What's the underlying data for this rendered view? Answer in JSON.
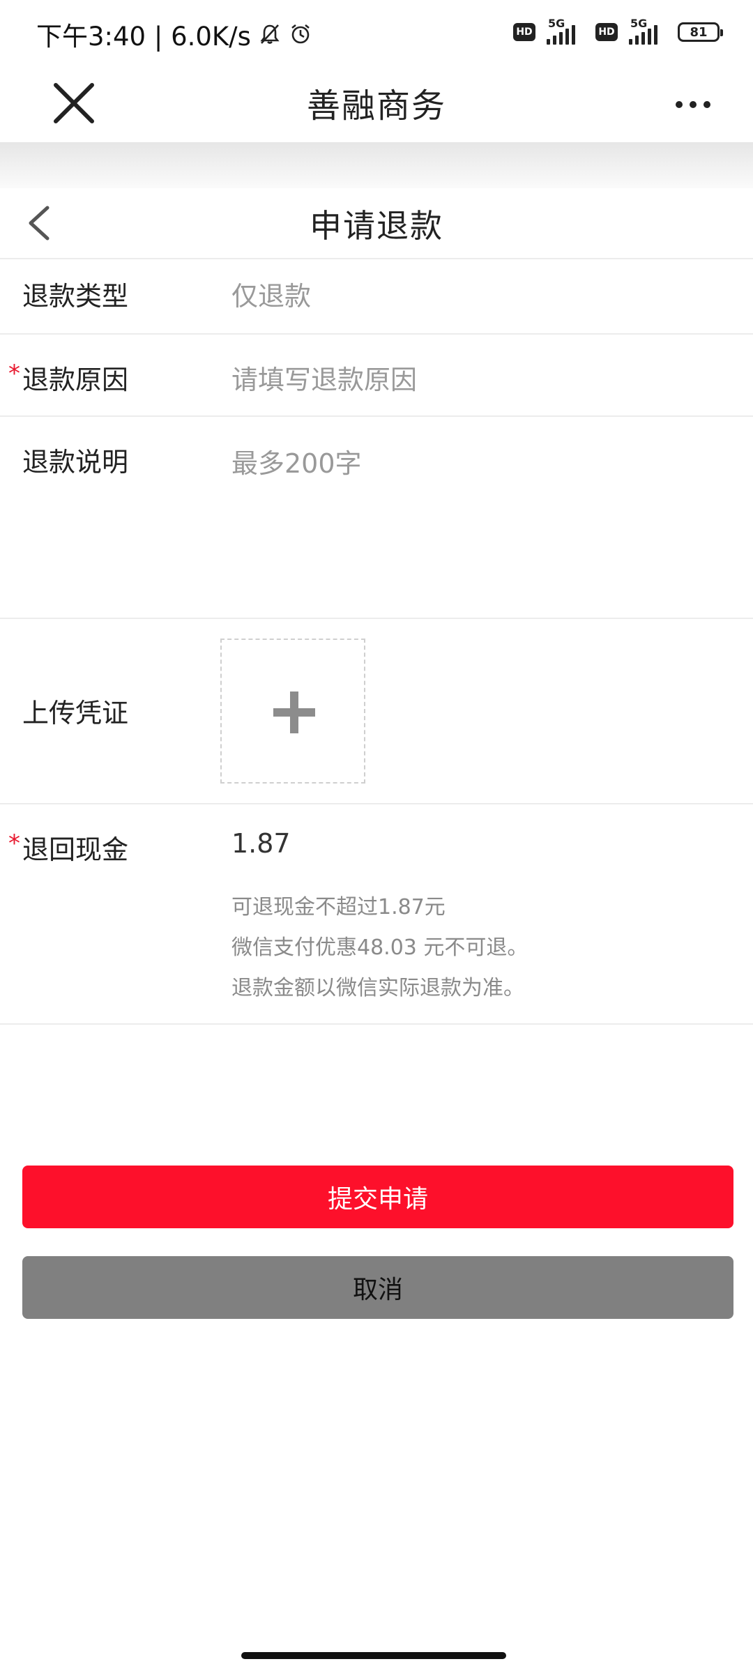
{
  "status_bar": {
    "time_speed": "下午3:40 | 6.0K/s",
    "icons": [
      "bell-muted-icon",
      "alarm-clock-icon",
      "hd-icon",
      "signal-5g-icon",
      "battery-icon"
    ],
    "network_1": "5G",
    "network_2": "5G",
    "hd_label": "HD",
    "battery_level": "81"
  },
  "navbar": {
    "title": "善融商务",
    "close_icon": "close-icon",
    "more_icon": "more-icon"
  },
  "page": {
    "title": "申请退款",
    "back_icon": "back-arrow-icon"
  },
  "form": {
    "refund_type": {
      "label": "退款类型",
      "value": "仅退款"
    },
    "refund_reason": {
      "required_mark": "*",
      "label": "退款原因",
      "placeholder": "请填写退款原因"
    },
    "refund_note": {
      "label": "退款说明",
      "placeholder": "最多200字"
    },
    "upload": {
      "label": "上传凭证",
      "icon": "plus-icon"
    },
    "refund_cash": {
      "required_mark": "*",
      "label": "退回现金",
      "value": "1.87",
      "hints": [
        "可退现金不超过1.87元",
        "微信支付优惠48.03 元不可退。",
        "退款金额以微信实际退款为准。"
      ]
    }
  },
  "buttons": {
    "submit": "提交申请",
    "cancel": "取消"
  },
  "colors": {
    "accent_red": "#fd102b",
    "cancel_gray": "#808080",
    "required_red": "#e8172d"
  }
}
